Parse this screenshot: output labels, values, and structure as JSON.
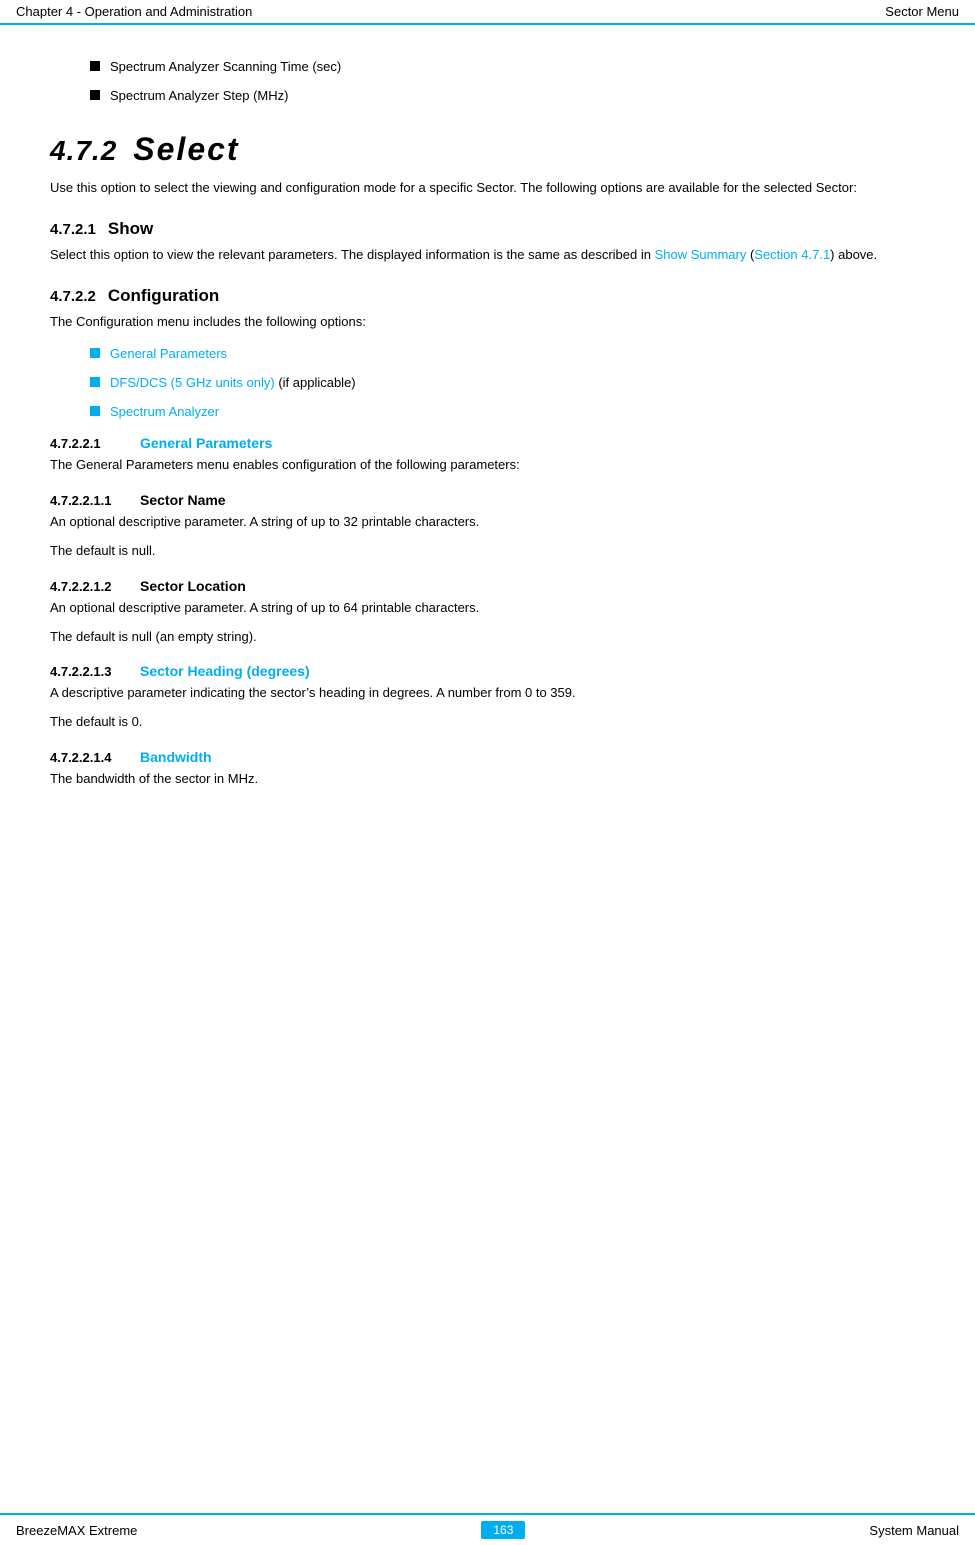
{
  "header": {
    "left": "Chapter 4 - Operation and Administration",
    "right": "Sector Menu"
  },
  "footer": {
    "left": "BreezeMAX Extreme",
    "center": "163",
    "right": "System Manual"
  },
  "content": {
    "bullet1": "Spectrum Analyzer Scanning Time (sec)",
    "bullet2": "Spectrum Analyzer Step (MHz)",
    "section472": {
      "num": "4.7.2",
      "title": "Select",
      "body": "Use this option to select the viewing and configuration mode for a specific Sector. The following options are available for the selected Sector:"
    },
    "section4721": {
      "num": "4.7.2.1",
      "title": "Show",
      "body1": "Select this option to view the relevant parameters. The displayed information is the same as described in ",
      "link1": "Show Summary",
      "body2": " (",
      "link2": "Section 4.7.1",
      "body3": ") above."
    },
    "section4722": {
      "num": "4.7.2.2",
      "title": "Configuration",
      "body": "The Configuration menu includes the following options:",
      "bullet1": "General Parameters",
      "bullet2": "DFS/DCS (5 GHz units only)",
      "bullet2_suffix": " (if applicable)",
      "bullet3": "Spectrum Analyzer"
    },
    "section47221": {
      "num": "4.7.2.2.1",
      "title": "General Parameters",
      "body": "The General Parameters menu enables configuration of the following parameters:"
    },
    "section472211": {
      "num": "4.7.2.2.1.1",
      "title": "Sector Name",
      "body1": "An optional descriptive parameter. A string of up to 32 printable characters.",
      "body2": "The default is null."
    },
    "section472212": {
      "num": "4.7.2.2.1.2",
      "title": "Sector Location",
      "body1": "An optional descriptive parameter. A string of up to 64 printable characters.",
      "body2": "The default is null (an empty string)."
    },
    "section472213": {
      "num": "4.7.2.2.1.3",
      "title": "Sector Heading (degrees)",
      "body1": "A descriptive parameter indicating the sector’s heading in degrees. A number from 0 to 359.",
      "body2": "The default is 0."
    },
    "section472214": {
      "num": "4.7.2.2.1.4",
      "title": "Bandwidth",
      "body1": "The bandwidth of the sector in MHz."
    }
  }
}
